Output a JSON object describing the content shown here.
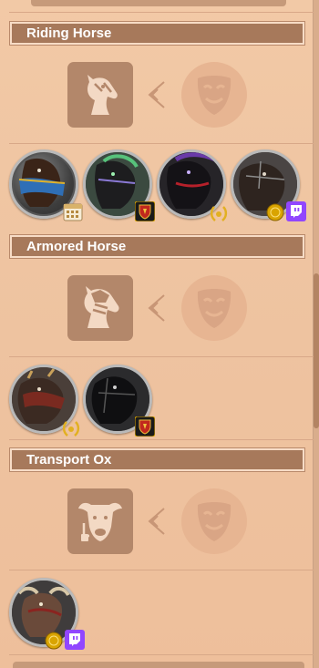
{
  "sections": [
    {
      "title": "Riding Horse",
      "mount_icon": "riding-horse-icon",
      "locked_icon": "mask-icon"
    },
    {
      "title": "Armored Horse",
      "mount_icon": "armored-horse-icon",
      "locked_icon": "mask-icon"
    },
    {
      "title": "Transport Ox",
      "mount_icon": "transport-ox-icon",
      "locked_icon": "mask-icon"
    }
  ],
  "skins": {
    "riding_horse": [
      {
        "name": "blue-armor-horse-skin",
        "badge": "calendar-icon"
      },
      {
        "name": "green-spectral-horse-skin",
        "badge": "guild-shield-icon"
      },
      {
        "name": "dark-purple-horse-skin",
        "badge": "laurel-icon"
      },
      {
        "name": "grey-horse-skin",
        "badge": "twitch-icon",
        "badge2": "gold-coin-icon"
      }
    ],
    "armored_horse": [
      {
        "name": "armored-horse-red-skin",
        "badge": "laurel-icon"
      },
      {
        "name": "black-armored-horse-skin",
        "badge": "guild-shield-icon"
      }
    ],
    "transport_ox": [
      {
        "name": "ox-skin",
        "badge": "twitch-icon",
        "badge2": "gold-coin-icon"
      }
    ]
  },
  "colors": {
    "panel_bg": "#efc4a0",
    "header_bg": "#a7795b",
    "tile_bg": "#b3876a",
    "twitch": "#9146ff",
    "shield_red": "#c1281e",
    "gold": "#d9a400"
  }
}
